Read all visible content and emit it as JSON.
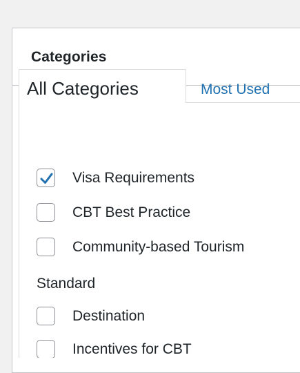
{
  "panel": {
    "title": "Categories"
  },
  "tabs": {
    "active_label": "All Categories",
    "inactive_label": "Most Used"
  },
  "categories": [
    {
      "label": "Visa Requirements",
      "checked": true
    },
    {
      "label": "CBT Best Practice",
      "checked": false
    },
    {
      "label": "Community-based Tourism",
      "checked": false
    },
    {
      "label": "Destination",
      "checked": false
    },
    {
      "label": "Incentives for CBT",
      "checked": false
    }
  ],
  "wrap_text": "Standard",
  "colors": {
    "accent": "#2271b1",
    "border": "#c3c4c7",
    "text": "#1d2327"
  },
  "icons": {
    "check": "checkmark-icon"
  }
}
